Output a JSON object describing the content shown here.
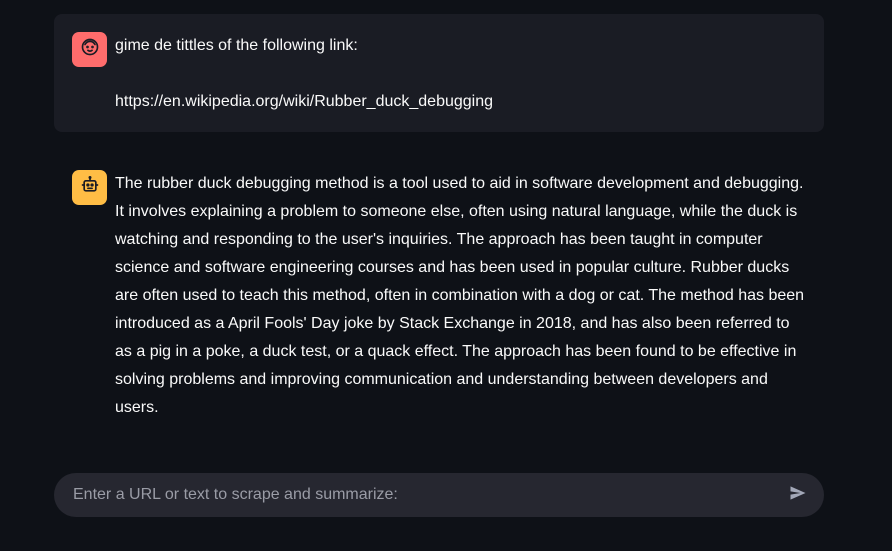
{
  "chat": {
    "messages": [
      {
        "role": "user",
        "avatar_icon": "user-face-icon",
        "lines": [
          "gime de tittles of the following link:",
          "https://en.wikipedia.org/wiki/Rubber_duck_debugging"
        ]
      },
      {
        "role": "assistant",
        "avatar_icon": "robot-icon",
        "text": "The rubber duck debugging method is a tool used to aid in software development and debugging. It involves explaining a problem to someone else, often using natural language, while the duck is watching and responding to the user's inquiries. The approach has been taught in computer science and software engineering courses and has been used in popular culture. Rubber ducks are often used to teach this method, often in combination with a dog or cat. The method has been introduced as a April Fools' Day joke by Stack Exchange in 2018, and has also been referred to as a pig in a poke, a duck test, or a quack effect. The approach has been found to be effective in solving problems and improving communication and understanding between developers and users."
      }
    ]
  },
  "input": {
    "placeholder": "Enter a URL or text to scrape and summarize:",
    "value": "",
    "send_icon": "send-icon"
  },
  "colors": {
    "background": "#0e1117",
    "user_bubble": "#1a1c24",
    "user_avatar": "#ff6c6c",
    "assistant_avatar": "#ffbd45",
    "input_bg": "#262730"
  }
}
